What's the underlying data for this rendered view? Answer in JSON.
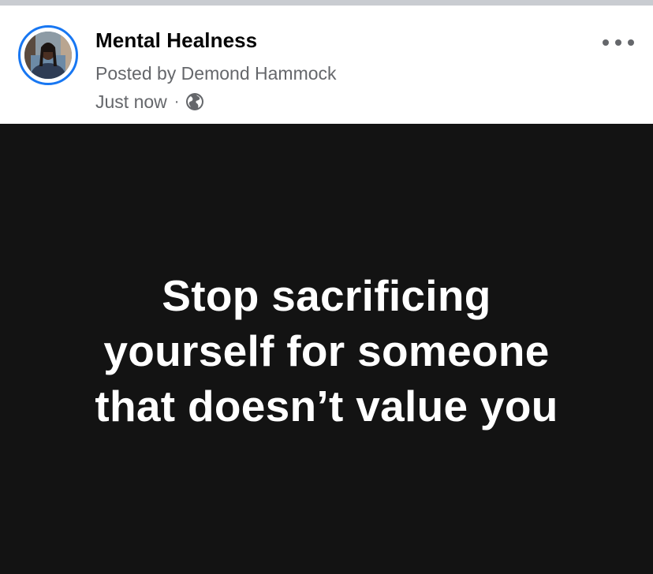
{
  "post": {
    "group_name": "Mental Healness",
    "posted_by": "Posted by Demond Hammock",
    "timestamp": "Just now",
    "separator": "·",
    "privacy_icon": "globe-icon",
    "more_icon": "more-options-icon",
    "quote_lines": [
      "Stop sacrificing",
      "yourself for someone",
      "that doesn’t value you"
    ]
  },
  "colors": {
    "accent": "#1877f2",
    "background_card": "#131313",
    "text_primary": "#050505",
    "text_secondary": "#65676b",
    "quote_text": "#ffffff"
  }
}
